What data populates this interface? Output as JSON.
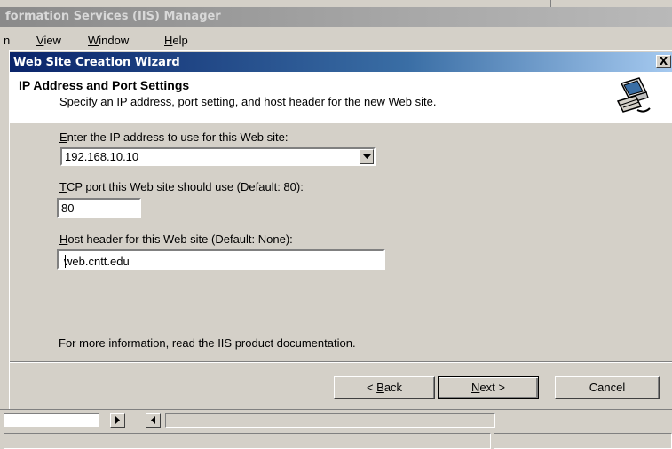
{
  "background_window": {
    "title": "formation Services (IIS) Manager",
    "menu": [
      {
        "label": "n"
      },
      {
        "label": "View",
        "mnemonic": "V",
        "rest": "iew"
      },
      {
        "label": "Window",
        "mnemonic": "W",
        "rest": "indow"
      },
      {
        "label": "Help",
        "mnemonic": "H",
        "rest": "elp"
      }
    ]
  },
  "dialog": {
    "title": "Web Site Creation Wizard",
    "close_label": "X",
    "header": {
      "title": "IP Address and Port Settings",
      "subtitle": "Specify an IP address, port setting, and host header for the new Web site.",
      "icon": "wizard-computer-icon"
    },
    "ip_field": {
      "mnemonic": "E",
      "label_rest": "nter the IP address to use for this Web site:",
      "value": "192.168.10.10"
    },
    "port_field": {
      "mnemonic": "T",
      "label_rest": "CP port this Web site should use (Default: 80):",
      "value": "80"
    },
    "host_field": {
      "mnemonic": "H",
      "label_rest": "ost header for this Web site (Default: None):",
      "value": "web.cntt.edu"
    },
    "info_text": "For more information, read the IIS product documentation.",
    "buttons": {
      "back": {
        "prefix": "< ",
        "mnemonic": "B",
        "rest": "ack"
      },
      "next": {
        "mnemonic": "N",
        "rest": "ext >"
      },
      "cancel": "Cancel"
    }
  },
  "colors": {
    "title_active": "#0a246a",
    "title_gradient_end": "#a6caf0",
    "face": "#d4d0c8"
  }
}
